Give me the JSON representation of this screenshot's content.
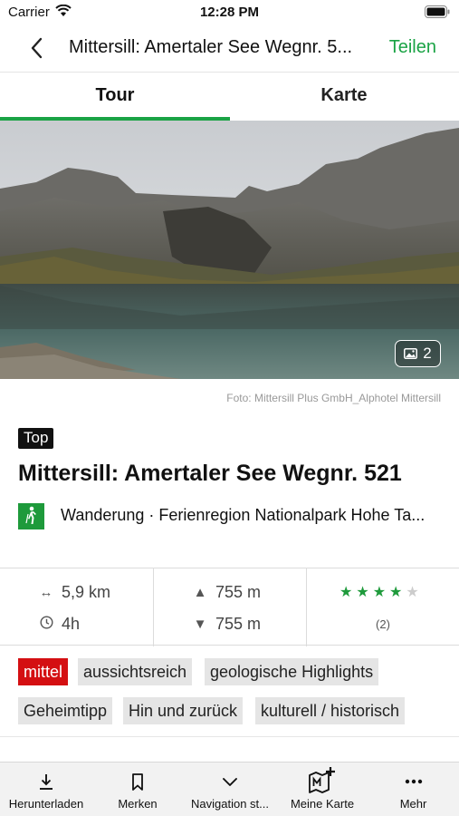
{
  "status_bar": {
    "carrier": "Carrier",
    "time": "12:28 PM"
  },
  "nav": {
    "title": "Mittersill: Amertaler See Wegnr. 5...",
    "share_label": "Teilen",
    "back_icon": "chevron-left-icon"
  },
  "tabs": [
    {
      "label": "Tour",
      "active": true
    },
    {
      "label": "Karte",
      "active": false
    }
  ],
  "hero": {
    "photo_count": "2",
    "credit": "Foto: Mittersill Plus GmbH_Alphotel Mittersill"
  },
  "tour": {
    "badge": "Top",
    "title": "Mittersill: Amertaler See Wegnr. 521",
    "category": "Wanderung · Ferienregion Nationalpark Hohe Ta...",
    "category_icon": "hiker-icon"
  },
  "stats": {
    "distance": "5,9 km",
    "duration": "4h",
    "ascent": "755 m",
    "descent": "755 m",
    "rating": 4,
    "rating_max": 5,
    "rating_count": "(2)"
  },
  "tags": {
    "difficulty": "mittel",
    "t1": "aussichtsreich",
    "t2": "geologische Highlights",
    "t3": "Geheimtipp",
    "t4": "Hin und zurück",
    "t5": "kulturell / historisch"
  },
  "bottom_bar": {
    "download": "Herunterladen",
    "bookmark": "Merken",
    "navigation": "Navigation st...",
    "my_map": "Meine Karte",
    "more": "Mehr"
  },
  "colors": {
    "accent": "#1aa345",
    "difficulty": "#d40f12"
  }
}
